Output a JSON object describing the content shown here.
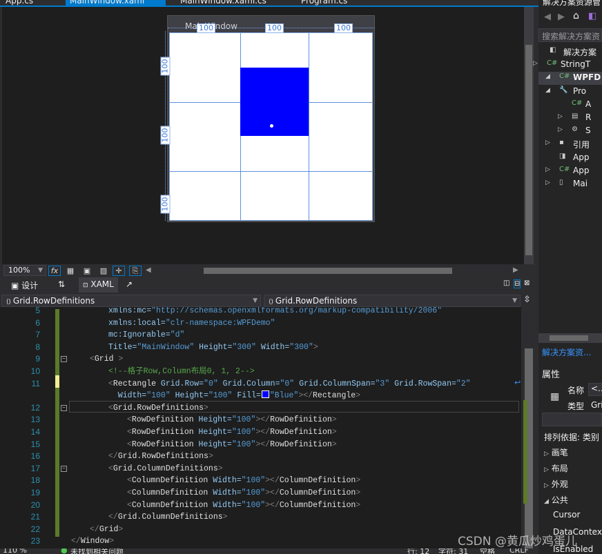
{
  "tabs": [
    {
      "label": "App.cs"
    },
    {
      "label": "MainWindow.xaml",
      "active": true
    },
    {
      "label": "MainWindow.xaml.cs"
    },
    {
      "label": "Program.cs"
    }
  ],
  "designer": {
    "window_title": "MainWindow",
    "column_labels": [
      "100",
      "100",
      "100"
    ],
    "row_labels": [
      "100",
      "100",
      "100"
    ],
    "rect_fill": "#0000ff",
    "zoom": "100%"
  },
  "view_tabs": {
    "design": "设计",
    "swap": "⇅",
    "xaml": "XAML"
  },
  "nav": {
    "left": "Grid.RowDefinitions",
    "right": "Grid.RowDefinitions"
  },
  "code_lines": [
    {
      "num": "5",
      "indent": 2,
      "tokens": [
        [
          "xmlns:mc=",
          "a"
        ],
        [
          "\"http://schemas.openxmlformats.org/markup-compatibility/2006\"",
          "v"
        ]
      ]
    },
    {
      "num": "6",
      "indent": 2,
      "tokens": [
        [
          "xmlns:local=",
          "a"
        ],
        [
          "\"clr-namespace:WPFDemo\"",
          "v"
        ]
      ]
    },
    {
      "num": "7",
      "indent": 2,
      "tokens": [
        [
          "mc:Ignorable=",
          "a"
        ],
        [
          "\"d\"",
          "v"
        ]
      ]
    },
    {
      "num": "8",
      "indent": 2,
      "tokens": [
        [
          "Title=",
          "a"
        ],
        [
          "\"MainWindow\"",
          "v"
        ],
        [
          " Height=",
          "a"
        ],
        [
          "\"300\"",
          "v"
        ],
        [
          " Width=",
          "a"
        ],
        [
          "\"300\"",
          "v"
        ],
        [
          ">",
          "b"
        ]
      ]
    },
    {
      "num": "9",
      "indent": 1,
      "tokens": [
        [
          "<",
          "b"
        ],
        [
          "Grid",
          "e"
        ],
        [
          " >",
          "b"
        ]
      ]
    },
    {
      "num": "10",
      "indent": 2,
      "tokens": [
        [
          "<!--格子Row,Column布局0, 1, 2-->",
          "c"
        ]
      ]
    },
    {
      "num": "11",
      "indent": 2,
      "tokens": [
        [
          "<",
          "b"
        ],
        [
          "Rectangle",
          "e"
        ],
        [
          " Grid.Row=",
          "a"
        ],
        [
          "\"0\"",
          "v"
        ],
        [
          " Grid.Column=",
          "a"
        ],
        [
          "\"0\"",
          "v"
        ],
        [
          " Grid.ColumnSpan=",
          "a"
        ],
        [
          "\"3\"",
          "v"
        ],
        [
          " Grid.RowSpan=",
          "a"
        ],
        [
          "\"2\"",
          "v"
        ]
      ]
    },
    {
      "num": "",
      "indent": 2,
      "cont": true,
      "tokens": [
        [
          "  Width=",
          "a"
        ],
        [
          "\"100\"",
          "v"
        ],
        [
          " Height=",
          "a"
        ],
        [
          "\"100\"",
          "v"
        ],
        [
          " Fill=",
          "a"
        ],
        [
          "■",
          "swatch"
        ],
        [
          "\"Blue\"",
          "v"
        ],
        [
          "></",
          "b"
        ],
        [
          "Rectangle",
          "e"
        ],
        [
          ">",
          "b"
        ]
      ]
    },
    {
      "num": "12",
      "indent": 2,
      "tokens": [
        [
          "<",
          "b"
        ],
        [
          "Grid.RowDefinitions",
          "e"
        ],
        [
          ">",
          "b"
        ]
      ]
    },
    {
      "num": "13",
      "indent": 3,
      "tokens": [
        [
          "<",
          "b"
        ],
        [
          "RowDefinition",
          "e"
        ],
        [
          " Height=",
          "a"
        ],
        [
          "\"100\"",
          "v"
        ],
        [
          "></",
          "b"
        ],
        [
          "RowDefinition",
          "e"
        ],
        [
          ">",
          "b"
        ]
      ]
    },
    {
      "num": "14",
      "indent": 3,
      "tokens": [
        [
          "<",
          "b"
        ],
        [
          "RowDefinition",
          "e"
        ],
        [
          " Height=",
          "a"
        ],
        [
          "\"100\"",
          "v"
        ],
        [
          "></",
          "b"
        ],
        [
          "RowDefinition",
          "e"
        ],
        [
          ">",
          "b"
        ]
      ]
    },
    {
      "num": "15",
      "indent": 3,
      "tokens": [
        [
          "<",
          "b"
        ],
        [
          "RowDefinition",
          "e"
        ],
        [
          " Height=",
          "a"
        ],
        [
          "\"100\"",
          "v"
        ],
        [
          "></",
          "b"
        ],
        [
          "RowDefinition",
          "e"
        ],
        [
          ">",
          "b"
        ]
      ]
    },
    {
      "num": "16",
      "indent": 2,
      "tokens": [
        [
          "</",
          "b"
        ],
        [
          "Grid.RowDefinitions",
          "e"
        ],
        [
          ">",
          "b"
        ]
      ]
    },
    {
      "num": "17",
      "indent": 2,
      "tokens": [
        [
          "<",
          "b"
        ],
        [
          "Grid.ColumnDefinitions",
          "e"
        ],
        [
          ">",
          "b"
        ]
      ]
    },
    {
      "num": "18",
      "indent": 3,
      "tokens": [
        [
          "<",
          "b"
        ],
        [
          "ColumnDefinition",
          "e"
        ],
        [
          " Width=",
          "a"
        ],
        [
          "\"100\"",
          "v"
        ],
        [
          "></",
          "b"
        ],
        [
          "ColumnDefinition",
          "e"
        ],
        [
          ">",
          "b"
        ]
      ]
    },
    {
      "num": "19",
      "indent": 3,
      "tokens": [
        [
          "<",
          "b"
        ],
        [
          "ColumnDefinition",
          "e"
        ],
        [
          " Width=",
          "a"
        ],
        [
          "\"100\"",
          "v"
        ],
        [
          "></",
          "b"
        ],
        [
          "ColumnDefinition",
          "e"
        ],
        [
          ">",
          "b"
        ]
      ]
    },
    {
      "num": "20",
      "indent": 3,
      "tokens": [
        [
          "<",
          "b"
        ],
        [
          "ColumnDefinition",
          "e"
        ],
        [
          " Width=",
          "a"
        ],
        [
          "\"100\"",
          "v"
        ],
        [
          "></",
          "b"
        ],
        [
          "ColumnDefinition",
          "e"
        ],
        [
          ">",
          "b"
        ]
      ]
    },
    {
      "num": "21",
      "indent": 2,
      "tokens": [
        [
          "</",
          "b"
        ],
        [
          "Grid.ColumnDefinitions",
          "e"
        ],
        [
          ">",
          "b"
        ]
      ]
    },
    {
      "num": "22",
      "indent": 1,
      "tokens": [
        [
          "</",
          "b"
        ],
        [
          "Grid",
          "e"
        ],
        [
          ">",
          "b"
        ]
      ]
    },
    {
      "num": "23",
      "indent": 0,
      "tokens": [
        [
          "</",
          "b"
        ],
        [
          "Window",
          "e"
        ],
        [
          ">",
          "b"
        ]
      ]
    }
  ],
  "status": {
    "zoom": "110 %",
    "issues": "未找到相关问题",
    "line": "行: 12",
    "char": "字符: 31",
    "space": "空格",
    "eol": "CRLF"
  },
  "solution_explorer": {
    "title": "解决方案资源管",
    "search_placeholder": "搜索解决方案资",
    "items": [
      {
        "label": "解决方案",
        "icon": "solution-icon",
        "expander": ""
      },
      {
        "label": "StringT",
        "icon": "csharp-project-icon",
        "expander": "▷"
      },
      {
        "label": "WPFD",
        "icon": "csharp-project-icon",
        "expander": "◢",
        "bold": true
      },
      {
        "label": "Pro",
        "icon": "wrench-icon",
        "expander": "◢"
      },
      {
        "label": "A",
        "icon": "csharp-file-icon",
        "expander": ""
      },
      {
        "label": "R",
        "icon": "resources-icon",
        "expander": "▷"
      },
      {
        "label": "S",
        "icon": "settings-icon",
        "expander": "▷"
      },
      {
        "label": "引用",
        "icon": "references-icon",
        "expander": "▷"
      },
      {
        "label": "App",
        "icon": "config-icon",
        "expander": ""
      },
      {
        "label": "App",
        "icon": "csharp-file-icon",
        "expander": "▷"
      },
      {
        "label": "Mai",
        "icon": "xaml-file-icon",
        "expander": "▷"
      }
    ],
    "link": "解决方案资..."
  },
  "properties": {
    "title": "属性",
    "name_label": "名称",
    "name_value": "<...",
    "type_label": "类型",
    "type_value": "Gri",
    "sort_by": "排列依据: 类别",
    "categories": [
      {
        "label": "画笔",
        "expander": "▷"
      },
      {
        "label": "布局",
        "expander": "▷"
      },
      {
        "label": "外观",
        "expander": "▷"
      },
      {
        "label": "公共",
        "expander": "◢"
      }
    ],
    "props": [
      "Cursor",
      "DataContext",
      "IsEnabled"
    ]
  },
  "watermark": "CSDN @黄瓜炒鸡蛋儿"
}
